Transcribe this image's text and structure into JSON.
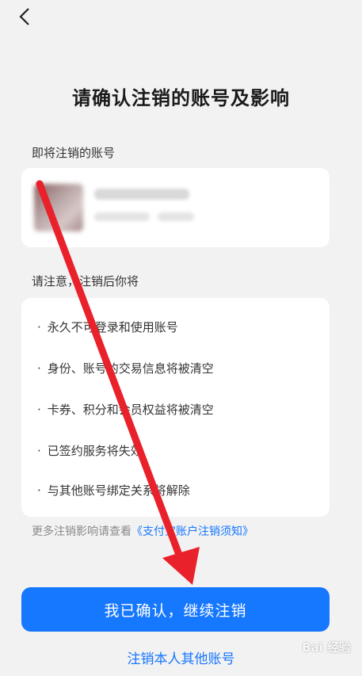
{
  "page": {
    "title": "请确认注销的账号及影响",
    "back_icon": "chevron-left-icon"
  },
  "account_section": {
    "label": "即将注销的账号"
  },
  "effects_section": {
    "label": "请注意，注销后你将",
    "bullet": "·",
    "items": [
      "永久不可登录和使用账号",
      "身份、账号的交易信息将被清空",
      "卡券、积分和会员权益将被清空",
      "已签约服务将失效",
      "与其他账号绑定关系将解除"
    ]
  },
  "more_info": {
    "prefix": "更多注销影响请查看",
    "link": "《支付宝账户注销须知》"
  },
  "actions": {
    "confirm_label": "我已确认，继续注销",
    "other_accounts_label": "注销本人其他账号"
  },
  "colors": {
    "accent": "#1677ff",
    "background": "#f2f2f2",
    "annotation_arrow": "#e8212b"
  },
  "watermark": {
    "text": "Bai 经验"
  }
}
